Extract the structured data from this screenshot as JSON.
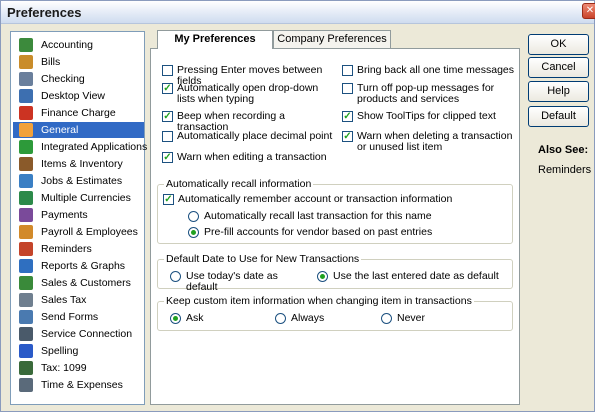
{
  "window": {
    "title": "Preferences",
    "close_glyph": "✕"
  },
  "sidebar": {
    "items": [
      {
        "label": "Accounting",
        "icon": "accounting-icon",
        "color": "#3c8a3c"
      },
      {
        "label": "Bills",
        "icon": "bills-icon",
        "color": "#c98c2a"
      },
      {
        "label": "Checking",
        "icon": "checking-icon",
        "color": "#6a7f9c"
      },
      {
        "label": "Desktop View",
        "icon": "desktop-view-icon",
        "color": "#3d6fb0"
      },
      {
        "label": "Finance Charge",
        "icon": "finance-charge-icon",
        "color": "#cc3322"
      },
      {
        "label": "General",
        "icon": "general-icon",
        "color": "#f2a13a"
      },
      {
        "label": "Integrated Applications",
        "icon": "integrated-apps-icon",
        "color": "#2d9a3a"
      },
      {
        "label": "Items & Inventory",
        "icon": "items-inventory-icon",
        "color": "#8a5a2a"
      },
      {
        "label": "Jobs & Estimates",
        "icon": "jobs-estimates-icon",
        "color": "#3a7fc4"
      },
      {
        "label": "Multiple Currencies",
        "icon": "multiple-currencies-icon",
        "color": "#2c8a4a"
      },
      {
        "label": "Payments",
        "icon": "payments-icon",
        "color": "#7a4a9a"
      },
      {
        "label": "Payroll & Employees",
        "icon": "payroll-employees-icon",
        "color": "#d28a2a"
      },
      {
        "label": "Reminders",
        "icon": "reminders-icon",
        "color": "#c4442a"
      },
      {
        "label": "Reports & Graphs",
        "icon": "reports-graphs-icon",
        "color": "#2f6fc0"
      },
      {
        "label": "Sales & Customers",
        "icon": "sales-customers-icon",
        "color": "#3a8a3a"
      },
      {
        "label": "Sales Tax",
        "icon": "sales-tax-icon",
        "color": "#6f7f8f"
      },
      {
        "label": "Send Forms",
        "icon": "send-forms-icon",
        "color": "#4a7ab0"
      },
      {
        "label": "Service Connection",
        "icon": "service-connection-icon",
        "color": "#4a5a6a"
      },
      {
        "label": "Spelling",
        "icon": "spelling-icon",
        "color": "#2a5ac8"
      },
      {
        "label": "Tax: 1099",
        "icon": "tax-1099-icon",
        "color": "#3a6a3a"
      },
      {
        "label": "Time & Expenses",
        "icon": "time-expenses-icon",
        "color": "#5a6a7a"
      }
    ],
    "selected": "General"
  },
  "tabs": [
    {
      "label": "My Preferences",
      "active": true
    },
    {
      "label": "Company Preferences",
      "active": false
    }
  ],
  "my_prefs": {
    "checkboxes": [
      {
        "label": "Pressing Enter moves between fields",
        "checked": false
      },
      {
        "label": "Bring back all one time messages",
        "checked": false
      },
      {
        "label": "Automatically open drop-down lists when typing",
        "checked": true
      },
      {
        "label": "Turn off pop-up messages for products and services",
        "checked": false
      },
      {
        "label": "Beep when recording a transaction",
        "checked": true
      },
      {
        "label": "Show ToolTips for clipped text",
        "checked": true
      },
      {
        "label": "Automatically place decimal point",
        "checked": false
      },
      {
        "label": "Warn when deleting a transaction or unused list item",
        "checked": true
      },
      {
        "label": "Warn when editing a transaction",
        "checked": true
      }
    ],
    "recall": {
      "title": "Automatically recall information",
      "remember_label": "Automatically remember account or transaction information",
      "remember_checked": true,
      "options": [
        {
          "label": "Automatically recall last transaction for this name",
          "selected": false
        },
        {
          "label": "Pre-fill accounts for vendor based on past entries",
          "selected": true
        }
      ]
    },
    "default_date": {
      "title": "Default Date to Use for New Transactions",
      "options": [
        {
          "label": "Use today's date as default",
          "selected": false
        },
        {
          "label": "Use the last entered date as default",
          "selected": true
        }
      ]
    },
    "custom_item": {
      "title": "Keep custom item information when changing item in transactions",
      "options": [
        {
          "label": "Ask",
          "selected": true
        },
        {
          "label": "Always",
          "selected": false
        },
        {
          "label": "Never",
          "selected": false
        }
      ]
    }
  },
  "buttons": {
    "ok": "OK",
    "cancel": "Cancel",
    "help": "Help",
    "default": "Default"
  },
  "also_see": {
    "title": "Also See:",
    "link": "Reminders"
  },
  "colors": {
    "selection": "#316ac5",
    "check_green": "#21a121",
    "titlebar": "#cfdcef"
  }
}
